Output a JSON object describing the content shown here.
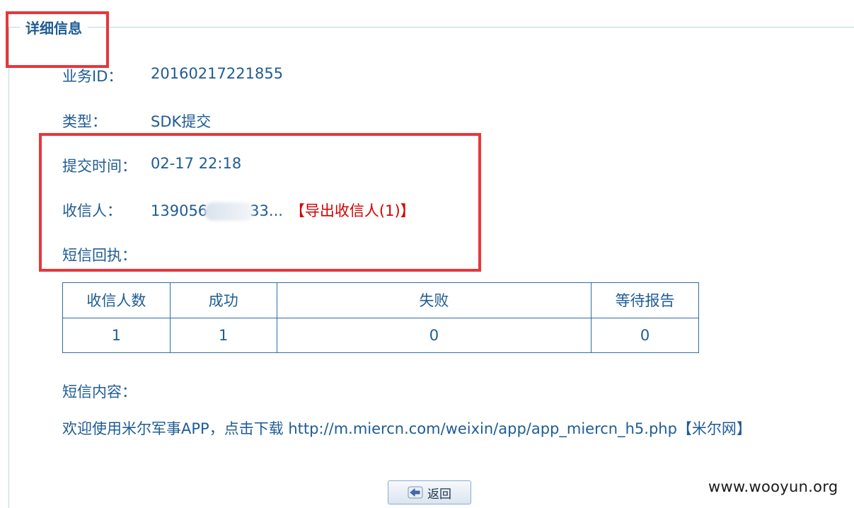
{
  "legend": "详细信息",
  "details": {
    "business_id_label": "业务ID：",
    "business_id_value": "20160217221855",
    "type_label": "类型：",
    "type_value": "SDK提交",
    "submit_time_label": "提交时间：",
    "submit_time_value": "02-17 22:18",
    "recipient_label": "收信人：",
    "recipient_value_start": "139056",
    "recipient_value_end": "33...",
    "export_link": "【导出收信人(1)】",
    "receipt_label": "短信回执："
  },
  "stats_table": {
    "headers": [
      "收信人数",
      "成功",
      "失败",
      "等待报告"
    ],
    "values": [
      "1",
      "1",
      "0",
      "0"
    ]
  },
  "sms": {
    "content_label": "短信内容：",
    "content_text": "欢迎使用米尔军事APP，点击下载 http://m.miercn.com/weixin/app/app_miercn_h5.php【米尔网】"
  },
  "buttons": {
    "back_label": "返回",
    "back_icon": "arrow-left-icon"
  },
  "watermark": "www.wooyun.org",
  "colors": {
    "text": "#1f5c94",
    "highlight_box": "#e8363c",
    "link_red": "#d40000",
    "table_border": "#2e6da4"
  }
}
